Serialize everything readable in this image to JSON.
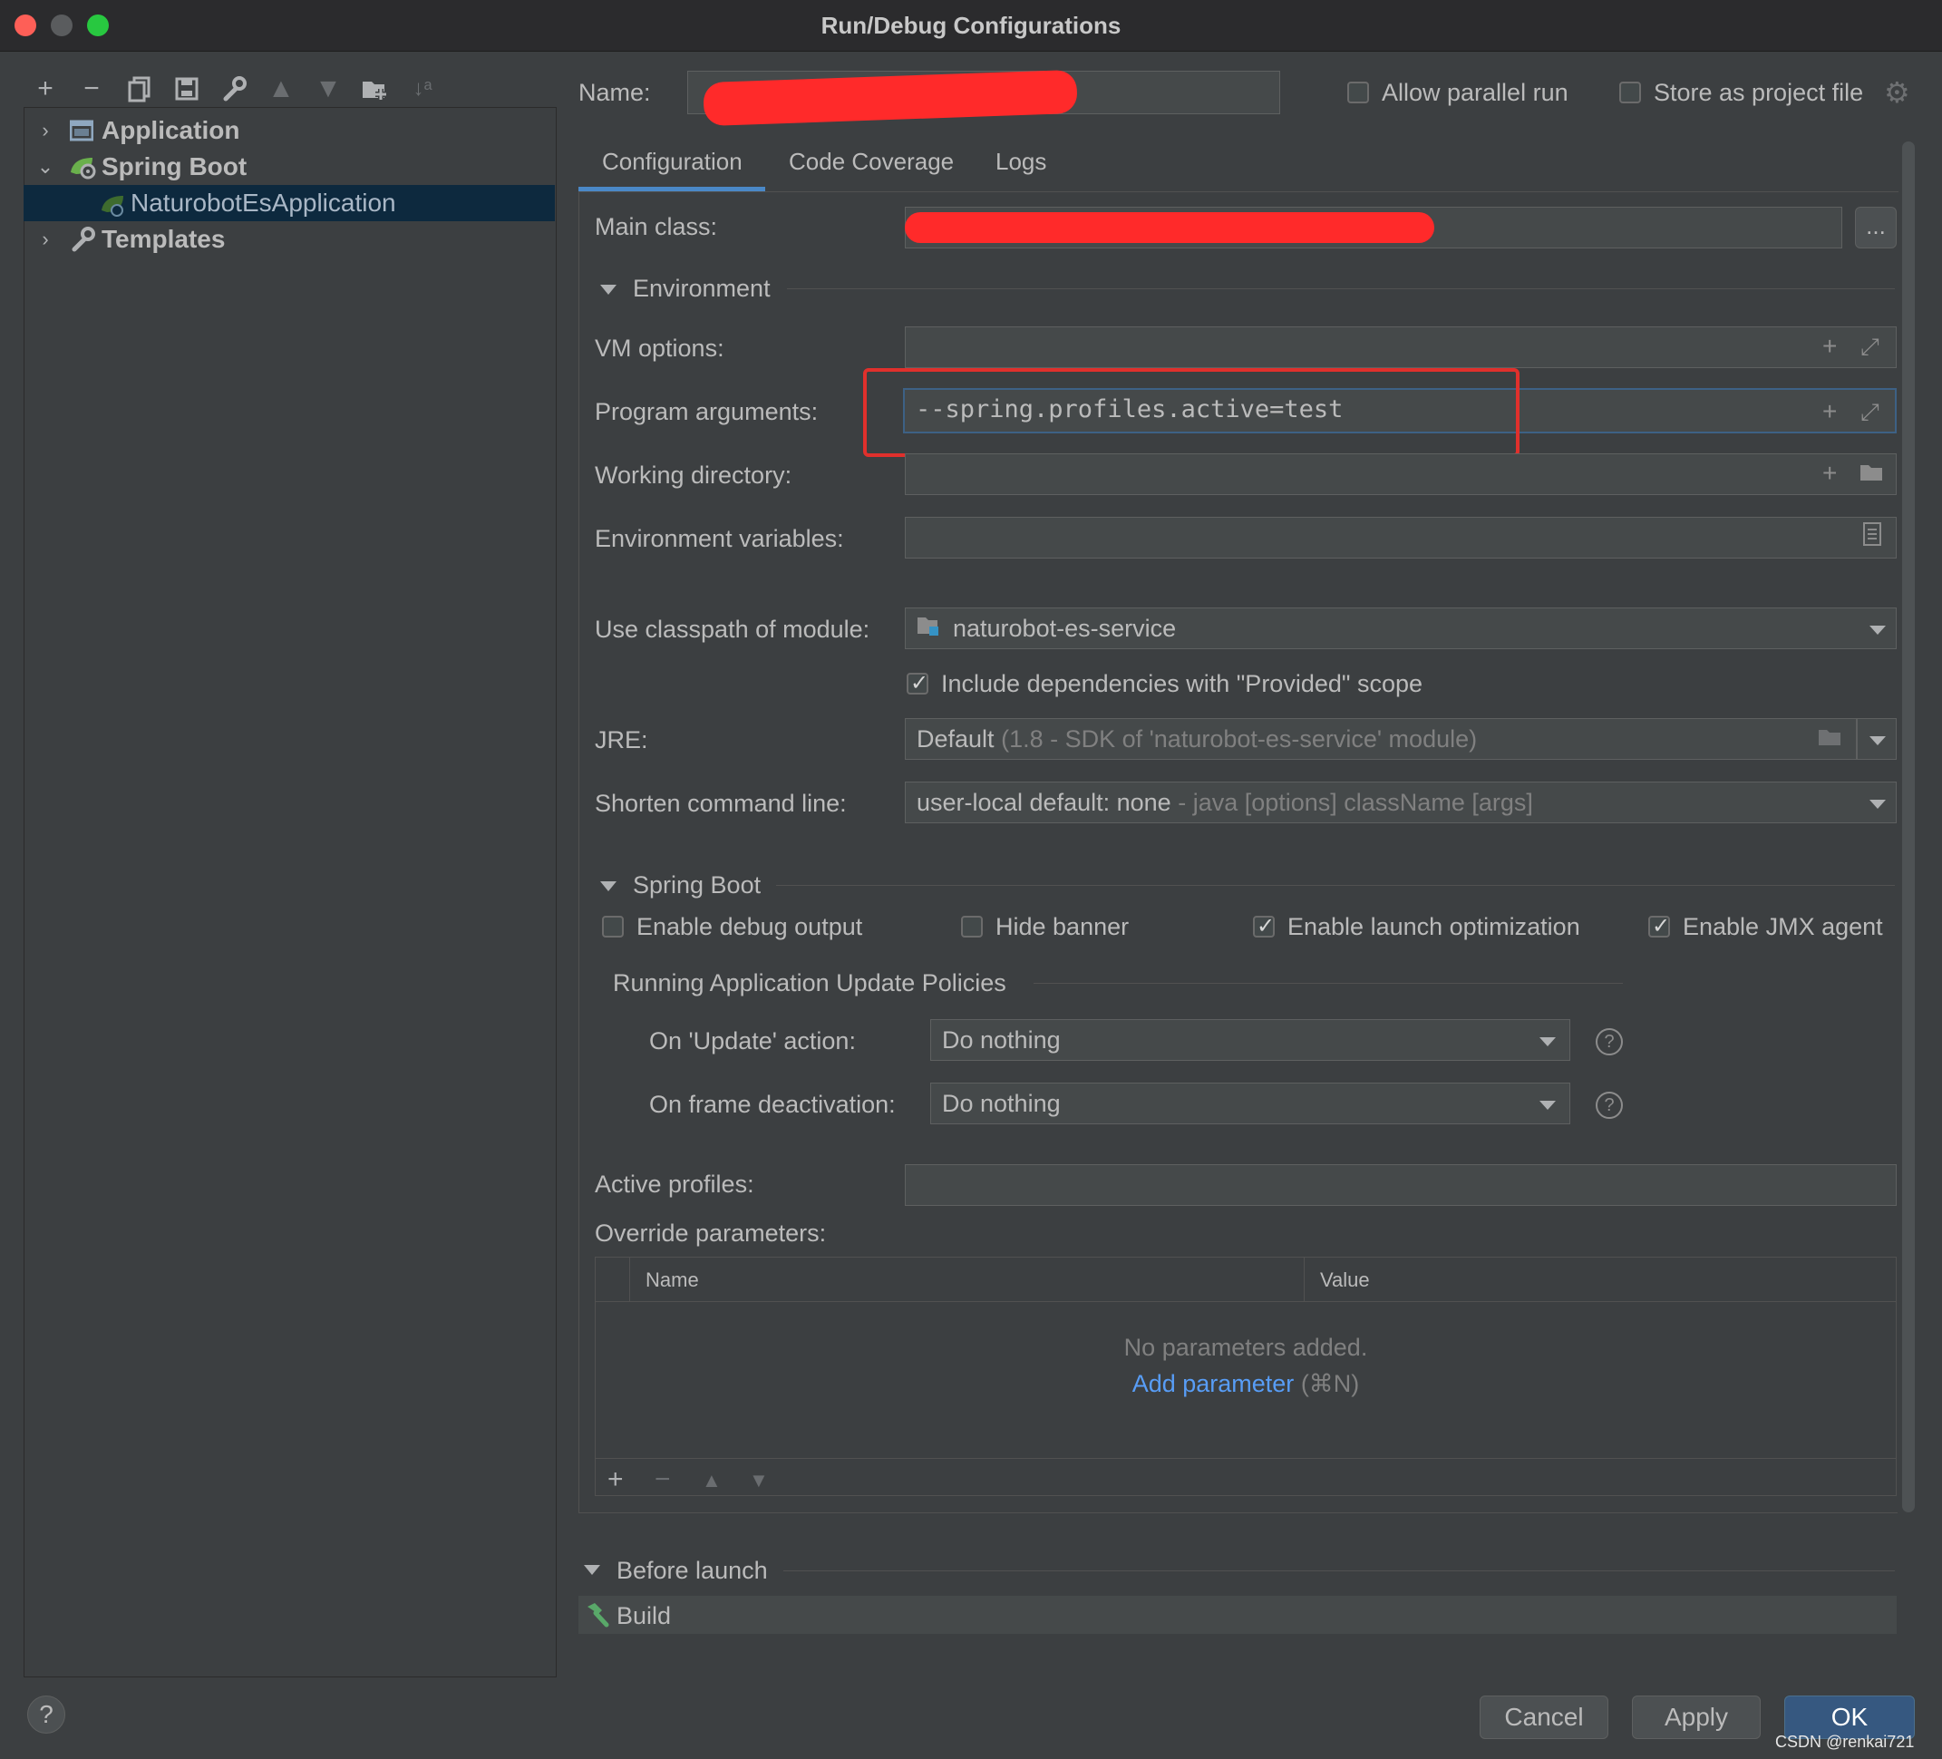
{
  "window": {
    "title": "Run/Debug Configurations"
  },
  "toolbar": {
    "icons": [
      "add-icon",
      "remove-icon",
      "copy-icon",
      "save-icon",
      "wrench-icon",
      "move-up-icon",
      "move-down-icon",
      "folder-add-icon",
      "sort-icon"
    ]
  },
  "tree": {
    "items": [
      {
        "label": "Application",
        "icon": "application-icon"
      },
      {
        "label": "Spring Boot",
        "icon": "spring-boot-icon"
      },
      {
        "label": "NaturobotEsApplication",
        "icon": "spring-boot-config-icon"
      },
      {
        "label": "Templates",
        "icon": "wrench-icon"
      }
    ]
  },
  "header": {
    "name_label": "Name:",
    "name_value": "",
    "allow_parallel_label": "Allow parallel run",
    "allow_parallel_checked": false,
    "store_project_label": "Store as project file",
    "store_project_checked": false
  },
  "tabs": [
    {
      "label": "Configuration",
      "active": true
    },
    {
      "label": "Code Coverage",
      "active": false
    },
    {
      "label": "Logs",
      "active": false
    }
  ],
  "config": {
    "main_class_label": "Main class:",
    "main_class_value": "",
    "browse_label": "...",
    "environment_title": "Environment",
    "vm_options_label": "VM options:",
    "vm_options_value": "",
    "program_args_label": "Program arguments:",
    "program_args_value": "--spring.profiles.active=test",
    "working_dir_label": "Working directory:",
    "working_dir_value": "",
    "env_vars_label": "Environment variables:",
    "env_vars_value": "",
    "classpath_label": "Use classpath of module:",
    "classpath_value": "naturobot-es-service",
    "include_deps_label": "Include dependencies with \"Provided\" scope",
    "include_deps_checked": true,
    "jre_label": "JRE:",
    "jre_value": "Default",
    "jre_detail": "(1.8 - SDK of 'naturobot-es-service' module)",
    "shorten_label": "Shorten command line:",
    "shorten_value": "user-local default: none",
    "shorten_detail": "- java [options] className [args]"
  },
  "spring": {
    "section_title": "Spring Boot",
    "debug_output_label": "Enable debug output",
    "debug_output_checked": false,
    "hide_banner_label": "Hide banner",
    "hide_banner_checked": false,
    "launch_opt_label": "Enable launch optimization",
    "launch_opt_checked": true,
    "jmx_label": "Enable JMX agent",
    "jmx_checked": true,
    "policies_title": "Running Application Update Policies",
    "update_action_label": "On 'Update' action:",
    "update_action_value": "Do nothing",
    "frame_deact_label": "On frame deactivation:",
    "frame_deact_value": "Do nothing",
    "active_profiles_label": "Active profiles:",
    "active_profiles_value": "",
    "override_label": "Override parameters:",
    "table_name_header": "Name",
    "table_value_header": "Value",
    "empty_text": "No parameters added.",
    "add_param_link": "Add parameter",
    "add_param_shortcut": "(⌘N)"
  },
  "before_launch": {
    "title": "Before launch",
    "items": [
      {
        "label": "Build",
        "icon": "hammer-icon"
      }
    ]
  },
  "footer": {
    "help_label": "?",
    "cancel_label": "Cancel",
    "apply_label": "Apply",
    "ok_label": "OK",
    "watermark": "CSDN @renkai721"
  },
  "colors": {
    "background": "#3c3f41",
    "selection": "#0d293e",
    "accent": "#4a88c7",
    "link": "#589df6",
    "redaction": "#ff2a2a",
    "annotation_box": "#e0302c"
  }
}
